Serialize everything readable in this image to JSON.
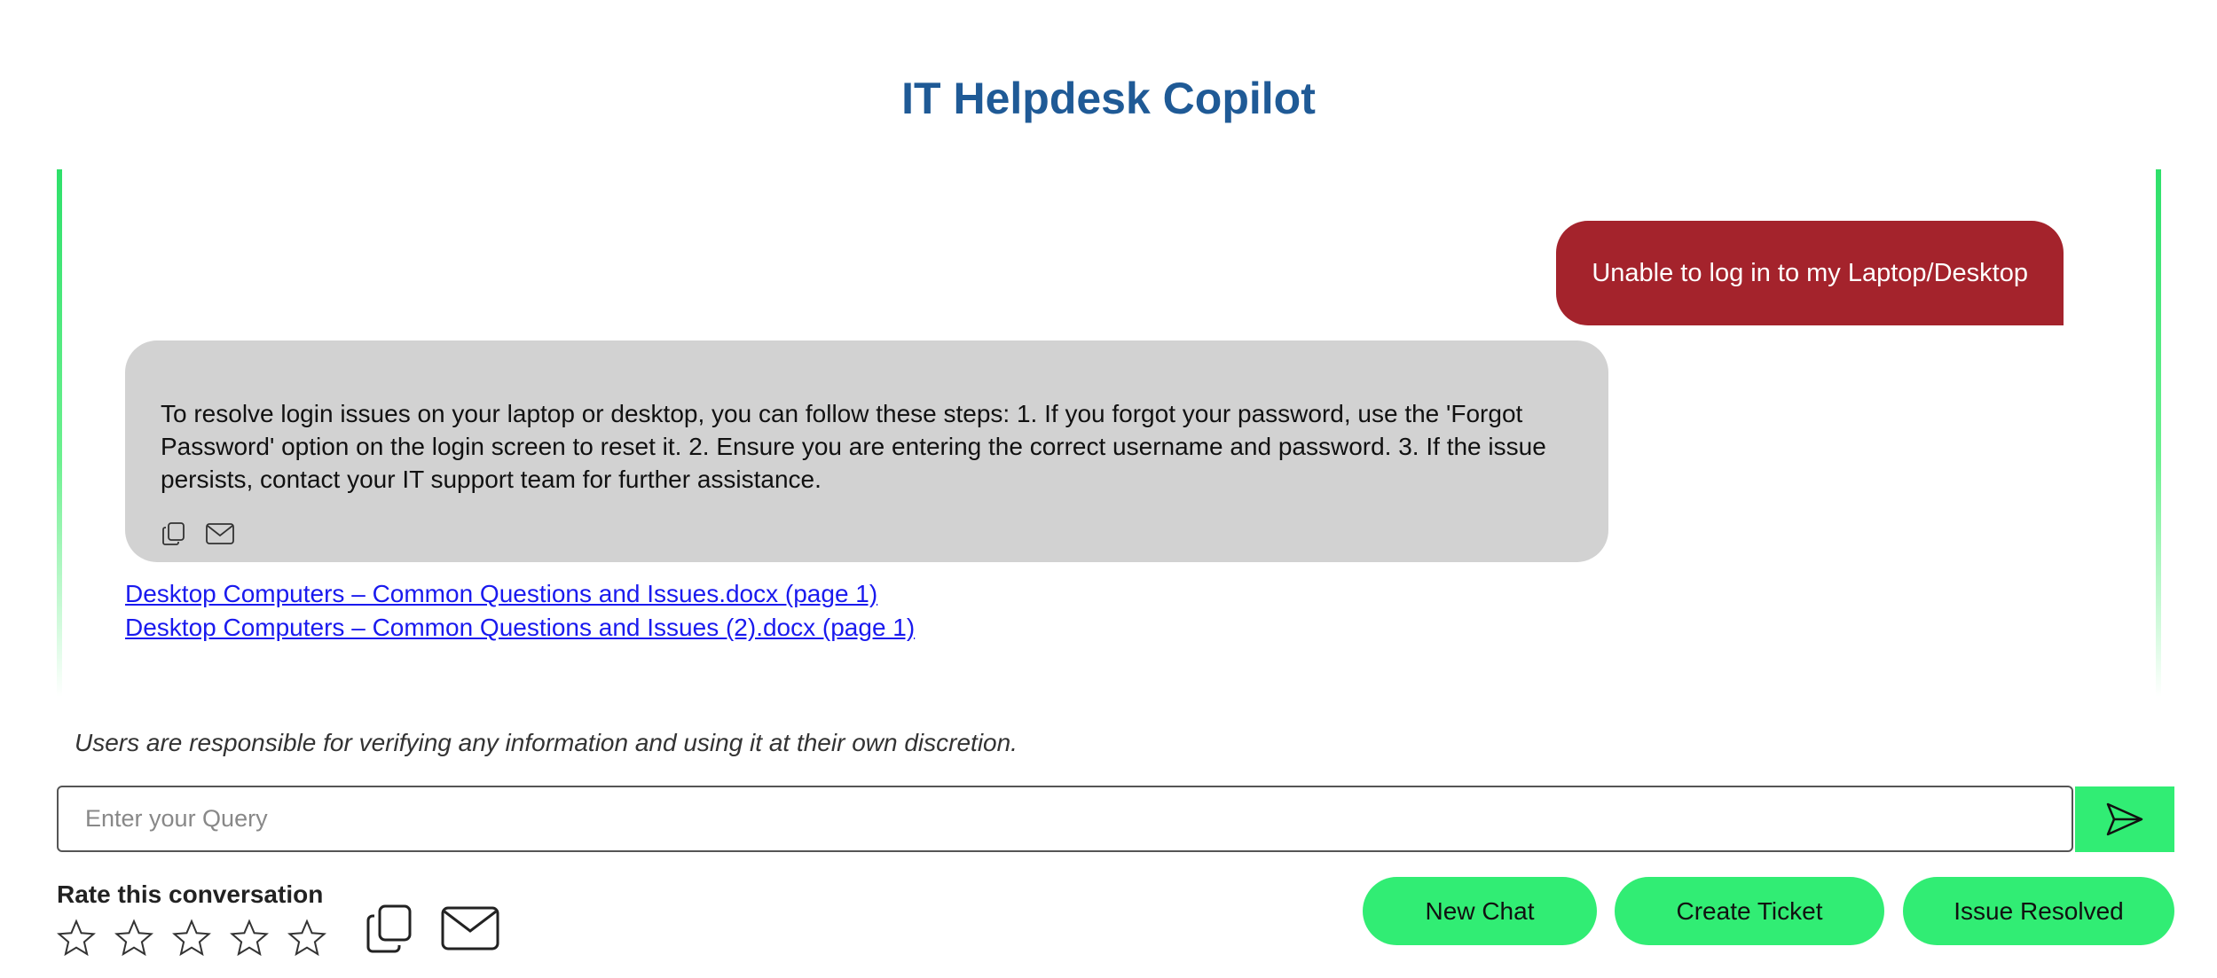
{
  "app": {
    "title": "IT Helpdesk Copilot"
  },
  "chat": {
    "user_message": "Unable to log in to my Laptop/Desktop",
    "bot_message": "To resolve login issues on your laptop or desktop, you can follow these steps: 1. If you forgot your password, use the 'Forgot Password' option on the login screen to reset it. 2. Ensure you are entering the correct username and password. 3. If the issue persists, contact your IT support team for further assistance.",
    "sources": [
      "Desktop Computers – Common Questions and Issues.docx (page 1)",
      "Desktop Computers – Common Questions and Issues (2).docx (page 1)"
    ],
    "bubble_icons": [
      "copy-icon",
      "mail-icon"
    ]
  },
  "disclaimer": "Users are responsible for verifying any information and using it at their own discretion.",
  "query": {
    "value": "",
    "placeholder": "Enter your Query",
    "send_icon": "send-icon"
  },
  "rating": {
    "label": "Rate this conversation",
    "stars_total": 5,
    "stars_selected": 0
  },
  "footer_icons": [
    "copy-icon",
    "mail-icon"
  ],
  "actions": {
    "new_chat": "New Chat",
    "create_ticket": "Create Ticket",
    "issue_resolved": "Issue Resolved"
  },
  "colors": {
    "title": "#1f5a96",
    "user_bubble": "#a4232c",
    "bot_bubble": "#d2d2d2",
    "accent": "#31ed74",
    "link": "#1a1aee"
  }
}
